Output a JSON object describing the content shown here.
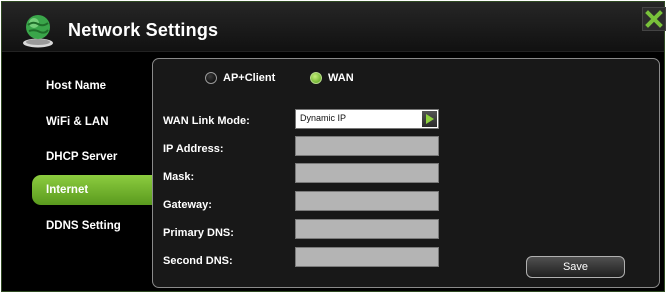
{
  "window": {
    "title": "Network Settings"
  },
  "sidebar": {
    "items": [
      {
        "label": "Host Name"
      },
      {
        "label": "WiFi & LAN"
      },
      {
        "label": "DHCP Server"
      },
      {
        "label": "Internet",
        "active": true
      },
      {
        "label": "DDNS Setting"
      }
    ]
  },
  "mode": {
    "options": [
      {
        "label": "AP+Client",
        "checked": false
      },
      {
        "label": "WAN",
        "checked": true
      }
    ]
  },
  "form": {
    "wan_link_mode": {
      "label": "WAN Link Mode:",
      "value": "Dynamic IP"
    },
    "ip_address": {
      "label": "IP Address:",
      "value": ""
    },
    "mask": {
      "label": "Mask:",
      "value": ""
    },
    "gateway": {
      "label": "Gateway:",
      "value": ""
    },
    "primary_dns": {
      "label": "Primary DNS:",
      "value": ""
    },
    "second_dns": {
      "label": "Second DNS:",
      "value": ""
    }
  },
  "actions": {
    "save_label": "Save"
  },
  "colors": {
    "accent": "#6fb12a",
    "panel_bg": "#181818",
    "field_bg": "#b4b4b4",
    "window_bg": "#000000"
  },
  "icons": {
    "title": "network-globe-icon",
    "close": "close-icon",
    "dropdown": "play-arrow-icon"
  }
}
